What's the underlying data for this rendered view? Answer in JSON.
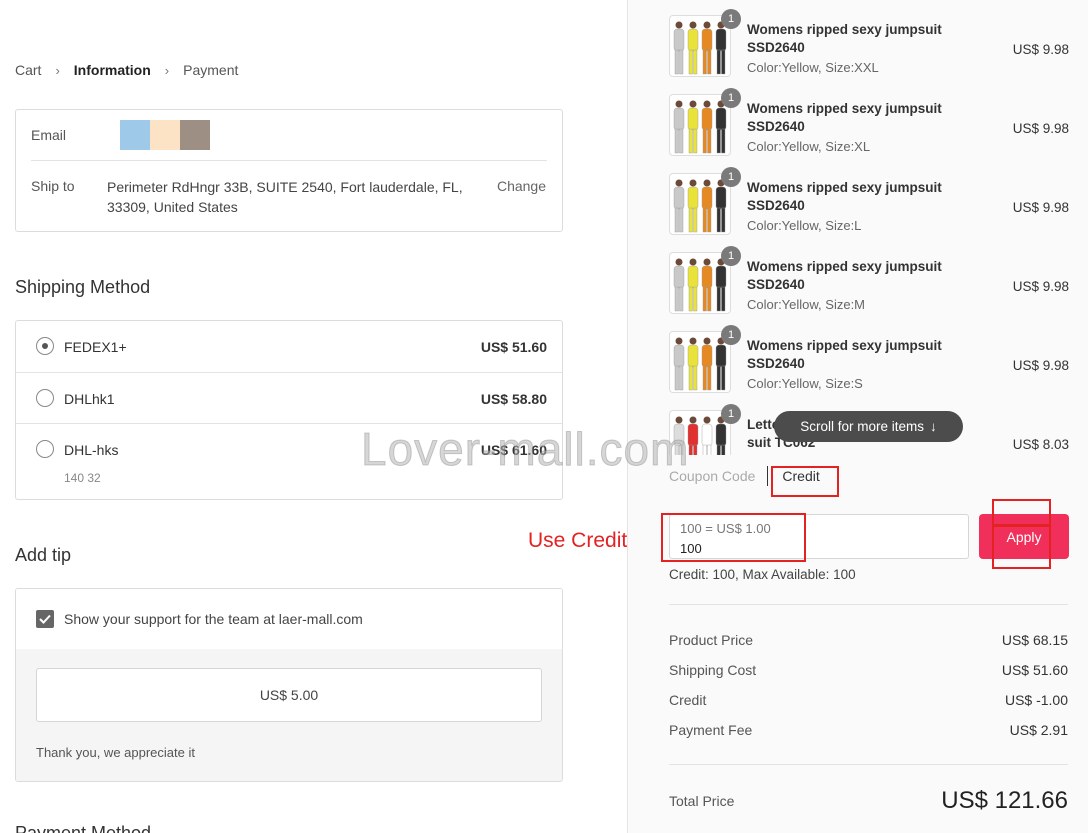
{
  "breadcrumb": {
    "cart": "Cart",
    "information": "Information",
    "payment": "Payment"
  },
  "contact": {
    "email_label": "Email",
    "email_swatch_colors": [
      "#9fc9e8",
      "#fde3c6",
      "#9d8f84"
    ],
    "ship_label": "Ship to",
    "ship_address": "Perimeter RdHngr 33B, SUITE 2540, Fort lauderdale, FL, 33309, United States",
    "change_label": "Change"
  },
  "shipping": {
    "title": "Shipping Method",
    "options": [
      {
        "name": "FEDEX1+",
        "price": "US$ 51.60",
        "selected": true,
        "sub": ""
      },
      {
        "name": "DHLhk1",
        "price": "US$ 58.80",
        "selected": false,
        "sub": ""
      },
      {
        "name": "DHL-hks",
        "price": "US$ 61.60",
        "selected": false,
        "sub": "140 32"
      }
    ]
  },
  "tip": {
    "title": "Add tip",
    "checkbox_label": "Show your support for the team at laer-mall.com",
    "checked": true,
    "amount": "US$ 5.00",
    "thanks": "Thank you, we appreciate it"
  },
  "payment_title": "Payment Method",
  "cart_items": [
    {
      "qty": "1",
      "title": "Womens ripped sexy jumpsuit SSD2640",
      "variant": "Color:Yellow, Size:XXL",
      "price": "US$ 9.98"
    },
    {
      "qty": "1",
      "title": "Womens ripped sexy jumpsuit SSD2640",
      "variant": "Color:Yellow, Size:XL",
      "price": "US$ 9.98"
    },
    {
      "qty": "1",
      "title": "Womens ripped sexy jumpsuit SSD2640",
      "variant": "Color:Yellow, Size:L",
      "price": "US$ 9.98"
    },
    {
      "qty": "1",
      "title": "Womens ripped sexy jumpsuit SSD2640",
      "variant": "Color:Yellow, Size:M",
      "price": "US$ 9.98"
    },
    {
      "qty": "1",
      "title": "Womens ripped sexy jumpsuit SSD2640",
      "variant": "Color:Yellow, Size:S",
      "price": "US$ 9.98"
    },
    {
      "qty": "1",
      "title": "Letter print casual suit two-piece suit TC062",
      "variant": "",
      "price": "US$ 8.03"
    }
  ],
  "scroll_hint": "Scroll for more items",
  "tabs": {
    "coupon": "Coupon Code",
    "credit": "Credit"
  },
  "credit": {
    "placeholder": "100 = US$ 1.00",
    "value": "100",
    "apply_label": "Apply",
    "available": "Credit: 100, Max Available: 100"
  },
  "summary": [
    {
      "label": "Product Price",
      "value": "US$ 68.15"
    },
    {
      "label": "Shipping Cost",
      "value": "US$ 51.60"
    },
    {
      "label": "Credit",
      "value": "US$ -1.00"
    },
    {
      "label": "Payment Fee",
      "value": "US$ 2.91"
    }
  ],
  "total": {
    "label": "Total Price",
    "value": "US$ 121.66"
  },
  "annotation": "Use Credit",
  "watermark": "Lover-mall.com",
  "colors": {
    "accent": "#f0305a",
    "annotation": "#e52222"
  }
}
